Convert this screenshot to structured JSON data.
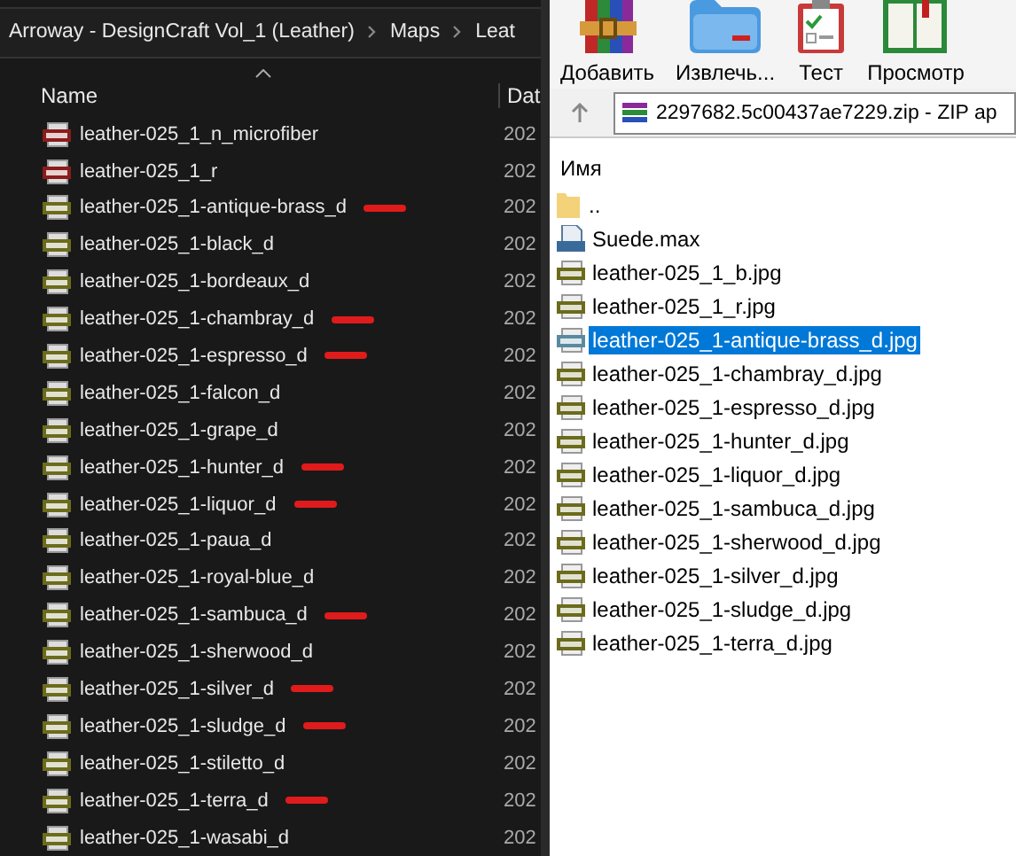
{
  "explorer": {
    "breadcrumb": [
      "Arroway - DesignCraft Vol_1 (Leather)",
      "Maps",
      "Leat"
    ],
    "columns": [
      "Name",
      "Dat"
    ],
    "rows": [
      {
        "kind": "png",
        "name": "leather-025_1_n_microfiber",
        "date": "202",
        "marked": false
      },
      {
        "kind": "png",
        "name": "leather-025_1_r",
        "date": "202",
        "marked": false
      },
      {
        "kind": "jpg",
        "name": "leather-025_1-antique-brass_d",
        "date": "202",
        "marked": true
      },
      {
        "kind": "jpg",
        "name": "leather-025_1-black_d",
        "date": "202",
        "marked": false
      },
      {
        "kind": "jpg",
        "name": "leather-025_1-bordeaux_d",
        "date": "202",
        "marked": false
      },
      {
        "kind": "jpg",
        "name": "leather-025_1-chambray_d",
        "date": "202",
        "marked": true
      },
      {
        "kind": "jpg",
        "name": "leather-025_1-espresso_d",
        "date": "202",
        "marked": true
      },
      {
        "kind": "jpg",
        "name": "leather-025_1-falcon_d",
        "date": "202",
        "marked": false
      },
      {
        "kind": "jpg",
        "name": "leather-025_1-grape_d",
        "date": "202",
        "marked": false
      },
      {
        "kind": "jpg",
        "name": "leather-025_1-hunter_d",
        "date": "202",
        "marked": true
      },
      {
        "kind": "jpg",
        "name": "leather-025_1-liquor_d",
        "date": "202",
        "marked": true
      },
      {
        "kind": "jpg",
        "name": "leather-025_1-paua_d",
        "date": "202",
        "marked": false
      },
      {
        "kind": "jpg",
        "name": "leather-025_1-royal-blue_d",
        "date": "202",
        "marked": false
      },
      {
        "kind": "jpg",
        "name": "leather-025_1-sambuca_d",
        "date": "202",
        "marked": true
      },
      {
        "kind": "jpg",
        "name": "leather-025_1-sherwood_d",
        "date": "202",
        "marked": false
      },
      {
        "kind": "jpg",
        "name": "leather-025_1-silver_d",
        "date": "202",
        "marked": true
      },
      {
        "kind": "jpg",
        "name": "leather-025_1-sludge_d",
        "date": "202",
        "marked": true
      },
      {
        "kind": "jpg",
        "name": "leather-025_1-stiletto_d",
        "date": "202",
        "marked": false
      },
      {
        "kind": "jpg",
        "name": "leather-025_1-terra_d",
        "date": "202",
        "marked": true
      },
      {
        "kind": "jpg",
        "name": "leather-025_1-wasabi_d",
        "date": "202",
        "marked": false
      }
    ]
  },
  "archiver": {
    "toolbar": [
      {
        "kind": "add",
        "label": "Добавить"
      },
      {
        "kind": "extract",
        "label": "Извлечь..."
      },
      {
        "kind": "test",
        "label": "Тест"
      },
      {
        "kind": "view",
        "label": "Просмотр"
      }
    ],
    "address": "2297682.5c00437ae7229.zip - ZIP ар",
    "column": "Имя",
    "rows": [
      {
        "kind": "folder",
        "name": "..",
        "selected": false
      },
      {
        "kind": "max",
        "name": "Suede.max",
        "selected": false
      },
      {
        "kind": "jpg",
        "name": "leather-025_1_b.jpg",
        "selected": false
      },
      {
        "kind": "jpg",
        "name": "leather-025_1_r.jpg",
        "selected": false
      },
      {
        "kind": "jpg",
        "name": "leather-025_1-antique-brass_d.jpg",
        "selected": true
      },
      {
        "kind": "jpg",
        "name": "leather-025_1-chambray_d.jpg",
        "selected": false
      },
      {
        "kind": "jpg",
        "name": "leather-025_1-espresso_d.jpg",
        "selected": false
      },
      {
        "kind": "jpg",
        "name": "leather-025_1-hunter_d.jpg",
        "selected": false
      },
      {
        "kind": "jpg",
        "name": "leather-025_1-liquor_d.jpg",
        "selected": false
      },
      {
        "kind": "jpg",
        "name": "leather-025_1-sambuca_d.jpg",
        "selected": false
      },
      {
        "kind": "jpg",
        "name": "leather-025_1-sherwood_d.jpg",
        "selected": false
      },
      {
        "kind": "jpg",
        "name": "leather-025_1-silver_d.jpg",
        "selected": false
      },
      {
        "kind": "jpg",
        "name": "leather-025_1-sludge_d.jpg",
        "selected": false
      },
      {
        "kind": "jpg",
        "name": "leather-025_1-terra_d.jpg",
        "selected": false
      }
    ]
  }
}
